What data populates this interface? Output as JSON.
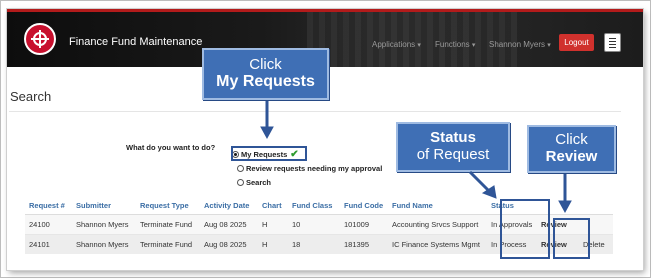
{
  "app": {
    "title": "Finance Fund Maintenance",
    "nav": [
      {
        "label": "Applications"
      },
      {
        "label": "Functions"
      },
      {
        "label": "Shannon Myers"
      }
    ],
    "logout_label": "Logout"
  },
  "page": {
    "title": "Search"
  },
  "search": {
    "question": "What do you want to do?",
    "options": [
      {
        "label": "My Requests",
        "selected": true
      },
      {
        "label": "Review requests needing my approval",
        "selected": false
      },
      {
        "label": "Search",
        "selected": false
      }
    ]
  },
  "table": {
    "columns": [
      "Request #",
      "Submitter",
      "Request Type",
      "Activity Date",
      "Chart",
      "Fund Class",
      "Fund Code",
      "Fund Name",
      "Status",
      "",
      ""
    ],
    "rows": [
      {
        "request": "24100",
        "submitter": "Shannon Myers",
        "type": "Terminate Fund",
        "date": "Aug 08 2025",
        "chart": "H",
        "fund_class": "10",
        "fund_code": "101009",
        "fund_name": "Accounting Srvcs Support",
        "status": "In Approvals",
        "review": "Review",
        "delete": ""
      },
      {
        "request": "24101",
        "submitter": "Shannon Myers",
        "type": "Terminate Fund",
        "date": "Aug 08 2025",
        "chart": "H",
        "fund_class": "18",
        "fund_code": "181395",
        "fund_name": "IC Finance Systems Mgmt",
        "status": "In Process",
        "review": "Review",
        "delete": "Delete"
      }
    ]
  },
  "callouts": {
    "my_requests": {
      "line1": "Click",
      "line2": "My Requests"
    },
    "status": {
      "line1": "Status",
      "line2": "of Request"
    },
    "review": {
      "line1": "Click",
      "line2": "Review"
    }
  },
  "colors": {
    "brand_red": "#c8102e",
    "callout_blue": "#3f6fb5",
    "link_blue": "#2a6bb8",
    "check_green": "#2e9b2e"
  }
}
